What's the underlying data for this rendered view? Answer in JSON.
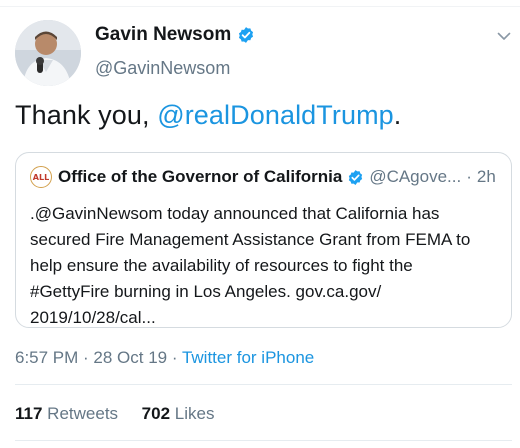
{
  "author": {
    "name": "Gavin Newsom",
    "handle": "@GavinNewsom",
    "avatar_icon": "person-avatar-icon",
    "verified": true
  },
  "tweet": {
    "text_prefix": "Thank you, ",
    "mention": "@realDonaldTrump",
    "text_suffix": "."
  },
  "quoted_tweet": {
    "seal_text": "ALL",
    "name": "Office of the Governor of California",
    "handle": "@CAgove...",
    "separator": "·",
    "time": "2h",
    "body_lines": [
      ".@GavinNewsom today announced that California has",
      "secured Fire Management Assistance Grant from FEMA to",
      "help ensure the availability of resources to fight the",
      "#GettyFire burning in Los Angeles. gov.ca.gov/",
      "2019/10/28/cal..."
    ]
  },
  "meta": {
    "time": "6:57 PM",
    "separator": " · ",
    "date": "28 Oct 19",
    "source": "Twitter for iPhone"
  },
  "stats": {
    "retweets_count": "117",
    "retweets_label": "Retweets",
    "likes_count": "702",
    "likes_label": "Likes"
  },
  "colors": {
    "link": "#1b95e0",
    "secondary_text": "#657786",
    "verified_badge": "#1da1f2"
  }
}
